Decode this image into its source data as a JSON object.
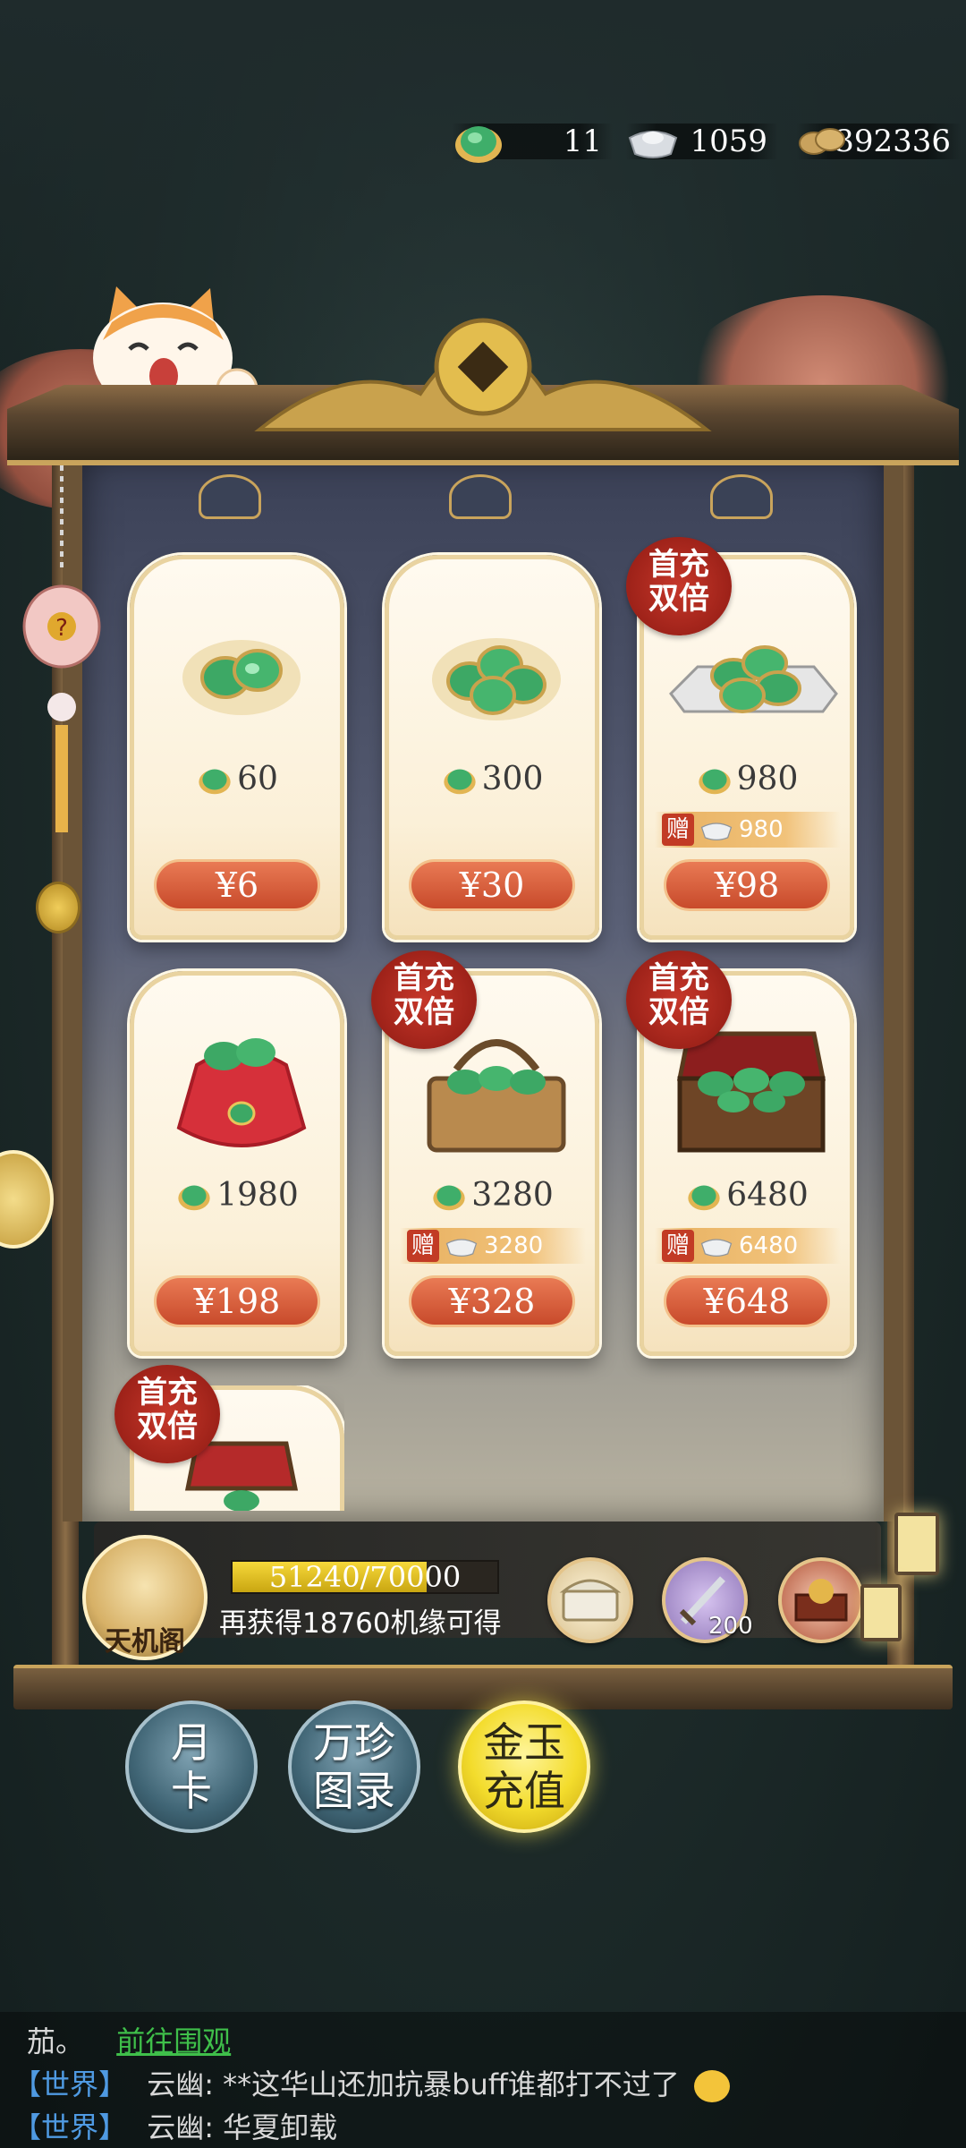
{
  "currencies": {
    "jade": {
      "icon": "jade-currency-icon",
      "value": "11"
    },
    "silver": {
      "icon": "silver-ingot-icon",
      "value": "1059"
    },
    "copper": {
      "icon": "copper-coins-icon",
      "value": "392336"
    }
  },
  "packages": [
    {
      "amount": "60",
      "price": "¥6",
      "badge": "",
      "bonus": ""
    },
    {
      "amount": "300",
      "price": "¥30",
      "badge": "",
      "bonus": ""
    },
    {
      "amount": "980",
      "price": "¥98",
      "badge": "首充双倍",
      "badge_line1": "首充",
      "badge_line2": "双倍",
      "bonus_label": "赠",
      "bonus": "980"
    },
    {
      "amount": "1980",
      "price": "¥198",
      "badge": "",
      "bonus": ""
    },
    {
      "amount": "3280",
      "price": "¥328",
      "badge": "首充双倍",
      "badge_line1": "首充",
      "badge_line2": "双倍",
      "bonus_label": "赠",
      "bonus": "3280"
    },
    {
      "amount": "6480",
      "price": "¥648",
      "badge": "首充双倍",
      "badge_line1": "首充",
      "badge_line2": "双倍",
      "bonus_label": "赠",
      "bonus": "6480"
    },
    {
      "badge_line1": "首充",
      "badge_line2": "双倍"
    }
  ],
  "progress": {
    "building_label": "天机阁",
    "text": "51240/70000",
    "fraction": 0.732,
    "tip": "再获得18760机缘可得",
    "rewards": [
      {
        "icon": "treasure-chest-icon",
        "count": ""
      },
      {
        "icon": "sword-icon",
        "count": "200"
      },
      {
        "icon": "ornate-box-icon",
        "count": ""
      }
    ]
  },
  "nav": {
    "monthly_card_line1": "月",
    "monthly_card_line2": "卡",
    "catalog_line1": "万珍",
    "catalog_line2": "图录",
    "recharge_line1": "金玉",
    "recharge_line2": "充值"
  },
  "chat": {
    "line1_text": "茄。",
    "line1_link": "前往围观",
    "line2_channel": "【世界】",
    "line2_text": "云幽: **这华山还加抗暴buff谁都打不过了",
    "line3_channel": "【世界】",
    "line3_text": "云幽: 华夏卸载"
  },
  "colors": {
    "price_button": "#c84a2b",
    "badge": "#9e2219",
    "active_nav": "#f3dc2c",
    "progress_fill": "#f6d83a",
    "world_channel": "#4f9ae2",
    "chat_link": "#3fbf4a"
  }
}
